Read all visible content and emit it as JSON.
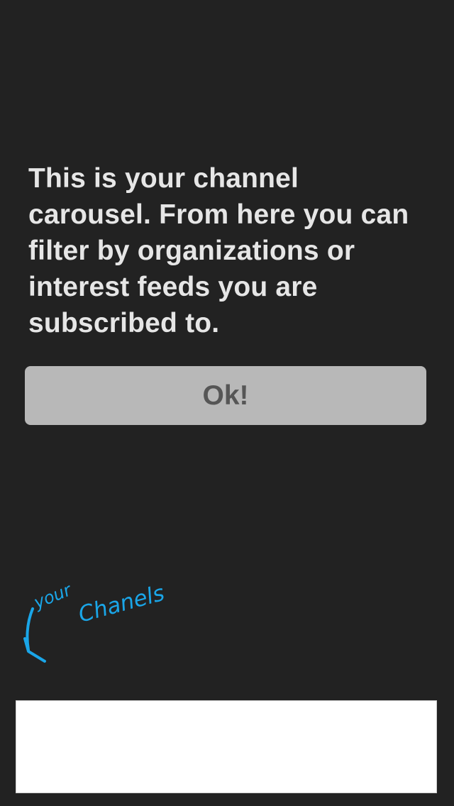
{
  "overlay": {
    "message": "This is your channel carousel. From here you can filter by organizations or interest feeds you are subscribed to.",
    "ok_label": "Ok!"
  },
  "annotation": {
    "text_line1": "your",
    "text_line2": "Chanels",
    "icon": "arrow-down-left-icon",
    "color": "#1aa6e8"
  },
  "colors": {
    "background": "#222222",
    "text": "#e6e6e6",
    "button_bg": "#b8b8b8",
    "button_text": "#565656",
    "carousel_bg": "#ffffff"
  }
}
